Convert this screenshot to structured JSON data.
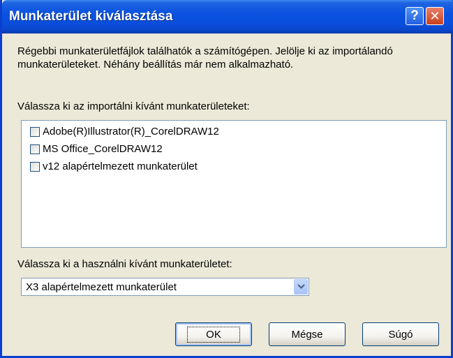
{
  "window": {
    "title": "Munkaterület kiválasztása",
    "help_glyph": "?",
    "close_glyph": "✕"
  },
  "intro_text": "Régebbi munkaterületfájlok találhatók a számítógépen. Jelölje ki az importálandó munkaterületeket. Néhány beállítás már nem alkalmazható.",
  "import_list": {
    "label": "Válassza ki az importálni kívánt munkaterületeket:",
    "items": [
      {
        "label": "Adobe(R)Illustrator(R)_CorelDRAW12",
        "checked": false
      },
      {
        "label": "MS Office_CorelDRAW12",
        "checked": false
      },
      {
        "label": "v12 alapértelmezett munkaterület",
        "checked": false
      }
    ]
  },
  "workspace_select": {
    "label": "Válassza ki a használni kívánt munkaterületet:",
    "value": "X3 alapértelmezett munkaterület"
  },
  "buttons": {
    "ok": "OK",
    "cancel": "Mégse",
    "help": "Súgó"
  },
  "colors": {
    "titlebar": "#0a4fdc",
    "dialog_bg": "#ece9d8",
    "border": "#7f9db9"
  }
}
